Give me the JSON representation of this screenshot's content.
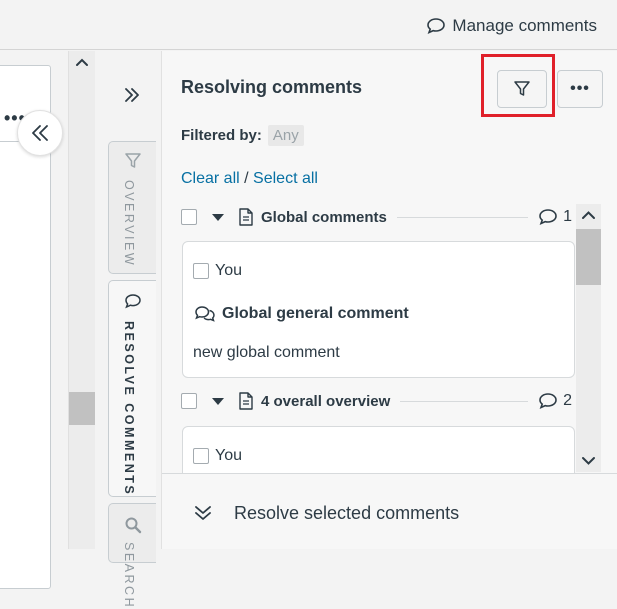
{
  "topbar": {
    "manage_comments": "Manage comments"
  },
  "tabs": [
    {
      "label": "Overview",
      "icon": "filter-icon"
    },
    {
      "label": "Resolve comments",
      "icon": "comment-icon",
      "active": true
    },
    {
      "label": "Search",
      "icon": "search-icon"
    }
  ],
  "panel": {
    "title": "Resolving comments",
    "filtered_by_label": "Filtered by:",
    "filtered_by_value": "Any",
    "clear_all": "Clear all",
    "separator": "/",
    "select_all": "Select all",
    "footer_action": "Resolve selected comments"
  },
  "groups": [
    {
      "title": "Global comments",
      "count": "1",
      "cards": [
        {
          "author": "You",
          "type": "Global general comment",
          "text": "new global comment"
        }
      ]
    },
    {
      "title": "4 overall overview",
      "count": "2",
      "cards": [
        {
          "author": "You"
        }
      ]
    }
  ],
  "colors": {
    "link": "#0770a3",
    "highlight": "#e0202a",
    "text": "#2d3b45"
  }
}
